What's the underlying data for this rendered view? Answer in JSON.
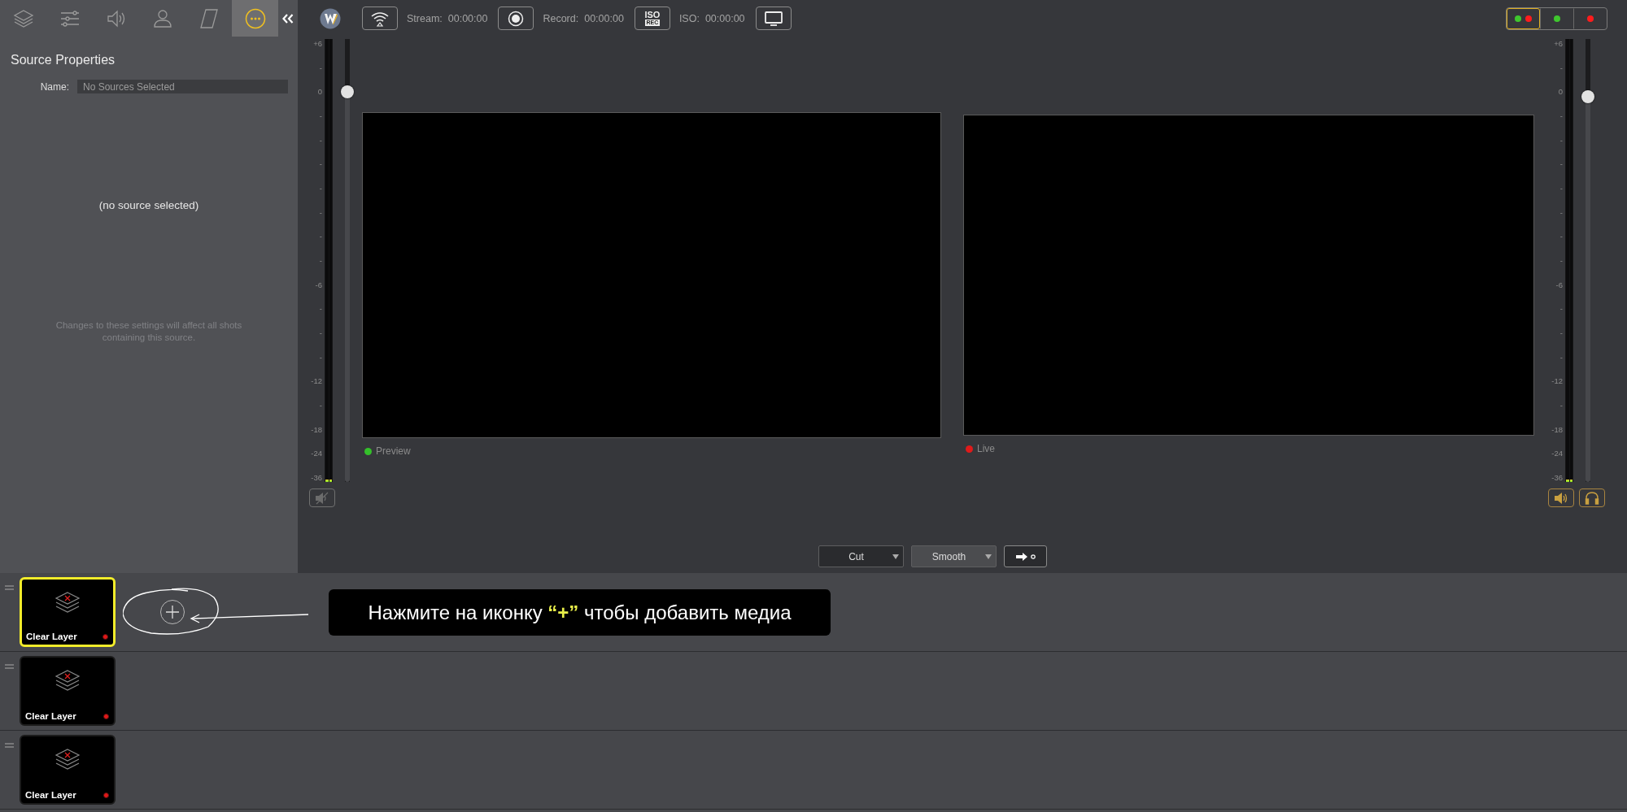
{
  "sidebar": {
    "tabs": [
      {
        "kind": "layers",
        "selected": false
      },
      {
        "kind": "sliders",
        "selected": false
      },
      {
        "kind": "speaker",
        "selected": false
      },
      {
        "kind": "person",
        "selected": false
      },
      {
        "kind": "shape",
        "selected": false
      },
      {
        "kind": "more",
        "selected": true
      }
    ],
    "title": "Source Properties",
    "name_label": "Name:",
    "name_field": {
      "placeholder": "No Sources Selected"
    },
    "empty_message": "(no source selected)",
    "note": "Changes to these settings will affect all shots containing this source."
  },
  "toolbar": {
    "items": [
      {
        "kind": "stream",
        "label": "Stream:",
        "time": "00:00:00"
      },
      {
        "kind": "record",
        "label": "Record:",
        "time": "00:00:00"
      },
      {
        "kind": "iso",
        "icon_lines": [
          "ISO",
          "REC"
        ],
        "label": "ISO:",
        "time": "00:00:00"
      },
      {
        "kind": "display"
      }
    ],
    "layout_buttons": [
      {
        "selected": true,
        "dots": [
          {
            "color": "#3fc72e"
          },
          {
            "color": "#ff1c1c"
          }
        ]
      },
      {
        "selected": false,
        "dots": [
          {
            "color": "#3fc72e"
          }
        ]
      },
      {
        "selected": false,
        "dots": [
          {
            "color": "#ff1c1c"
          }
        ]
      }
    ]
  },
  "meters": [
    {
      "scale": [
        "+6",
        "-",
        "0",
        "-",
        "-",
        "-",
        "-",
        "-",
        "-",
        "-",
        "-6",
        "-",
        "-",
        "-",
        "-12",
        "-",
        "-18",
        "-24",
        "-36"
      ],
      "level": 0.88,
      "buttons": [
        {
          "kind": "mute",
          "active": false
        }
      ]
    },
    {
      "scale": [
        "+6",
        "-",
        "0",
        "-",
        "-",
        "-",
        "-",
        "-",
        "-",
        "-",
        "-6",
        "-",
        "-",
        "-",
        "-12",
        "-",
        "-18",
        "-24",
        "-36"
      ],
      "level": 0.87,
      "buttons": [
        {
          "kind": "speaker",
          "active": true
        },
        {
          "kind": "headphones",
          "active": true
        }
      ]
    }
  ],
  "monitors": [
    {
      "label": "Preview",
      "color": "#34c02a"
    },
    {
      "label": "Live",
      "color": "#e01a1a"
    }
  ],
  "transition": {
    "type": {
      "value": "Cut"
    },
    "effect": {
      "value": "Smooth"
    }
  },
  "layers": [
    {
      "shots": [
        {
          "label": "Clear Layer",
          "selected": true
        }
      ],
      "show_add": true
    },
    {
      "shots": [
        {
          "label": "Clear Layer",
          "selected": false
        }
      ],
      "show_add": false
    },
    {
      "shots": [
        {
          "label": "Clear Layer",
          "selected": false
        }
      ],
      "show_add": false
    }
  ],
  "callout": {
    "parts": [
      {
        "text": "Нажмите на иконку ",
        "highlighted": false
      },
      {
        "text": "“+”",
        "highlighted": true
      },
      {
        "text": " чтобы добавить медиа",
        "highlighted": false
      }
    ]
  }
}
